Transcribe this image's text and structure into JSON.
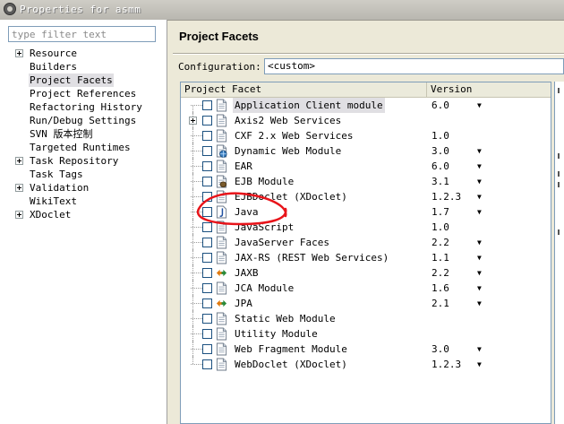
{
  "window": {
    "title": "Properties for asmm"
  },
  "filter": {
    "placeholder": "type filter text"
  },
  "nav": [
    {
      "label": "Resource",
      "expandable": true
    },
    {
      "label": "Builders",
      "expandable": false
    },
    {
      "label": "Project Facets",
      "expandable": false,
      "selected": true
    },
    {
      "label": "Project References",
      "expandable": false
    },
    {
      "label": "Refactoring History",
      "expandable": false
    },
    {
      "label": "Run/Debug Settings",
      "expandable": false
    },
    {
      "label": "SVN 版本控制",
      "expandable": false
    },
    {
      "label": "Targeted Runtimes",
      "expandable": false
    },
    {
      "label": "Task Repository",
      "expandable": true
    },
    {
      "label": "Task Tags",
      "expandable": false
    },
    {
      "label": "Validation",
      "expandable": true
    },
    {
      "label": "WikiText",
      "expandable": false
    },
    {
      "label": "XDoclet",
      "expandable": true
    }
  ],
  "page": {
    "title": "Project Facets",
    "configuration_label": "Configuration:",
    "configuration_value": "<custom>"
  },
  "table": {
    "columns": [
      "Project Facet",
      "Version"
    ],
    "rows": [
      {
        "name": "Application Client module",
        "version": "6.0",
        "dropdown": true,
        "icon": "page-icon",
        "selected": true
      },
      {
        "name": "Axis2 Web Services",
        "version": "",
        "dropdown": false,
        "icon": "page-icon",
        "expandable": true
      },
      {
        "name": "CXF 2.x Web Services",
        "version": "1.0",
        "dropdown": false,
        "icon": "page-icon"
      },
      {
        "name": "Dynamic Web Module",
        "version": "3.0",
        "dropdown": true,
        "icon": "globe-page-icon"
      },
      {
        "name": "EAR",
        "version": "6.0",
        "dropdown": true,
        "icon": "page-icon"
      },
      {
        "name": "EJB Module",
        "version": "3.1",
        "dropdown": true,
        "icon": "bean-page-icon"
      },
      {
        "name": "EJBDoclet (XDoclet)",
        "version": "1.2.3",
        "dropdown": true,
        "icon": "page-icon"
      },
      {
        "name": "Java",
        "version": "1.7",
        "dropdown": true,
        "icon": "java-icon"
      },
      {
        "name": "JavaScript",
        "version": "1.0",
        "dropdown": false,
        "icon": "page-icon"
      },
      {
        "name": "JavaServer Faces",
        "version": "2.2",
        "dropdown": true,
        "icon": "page-icon"
      },
      {
        "name": "JAX-RS (REST Web Services)",
        "version": "1.1",
        "dropdown": true,
        "icon": "page-icon"
      },
      {
        "name": "JAXB",
        "version": "2.2",
        "dropdown": true,
        "icon": "arrows-icon"
      },
      {
        "name": "JCA Module",
        "version": "1.6",
        "dropdown": true,
        "icon": "page-icon"
      },
      {
        "name": "JPA",
        "version": "2.1",
        "dropdown": true,
        "icon": "arrows-icon"
      },
      {
        "name": "Static Web Module",
        "version": "",
        "dropdown": false,
        "icon": "page-icon"
      },
      {
        "name": "Utility Module",
        "version": "",
        "dropdown": false,
        "icon": "page-icon"
      },
      {
        "name": "Web Fragment Module",
        "version": "3.0",
        "dropdown": true,
        "icon": "page-icon"
      },
      {
        "name": "WebDoclet (XDoclet)",
        "version": "1.2.3",
        "dropdown": true,
        "icon": "page-icon"
      }
    ]
  },
  "colors": {
    "annotation": "#e8141a",
    "selection": "#e0dfe3",
    "checkbox_border": "#1c5180"
  }
}
